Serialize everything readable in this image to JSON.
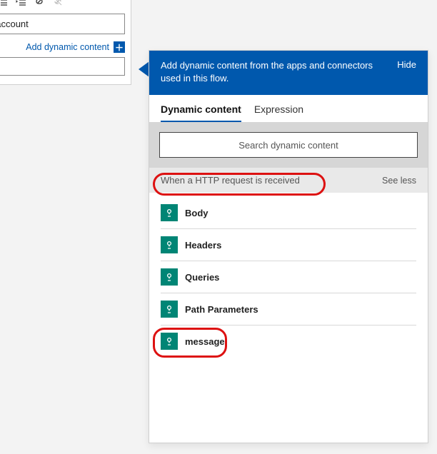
{
  "editor": {
    "text": "me test account",
    "add_dynamic_label": "Add dynamic content",
    "toolbar": {
      "ordered": "ordered-list-icon",
      "unordered": "unordered-list-icon",
      "outdent": "outdent-icon",
      "indent": "indent-icon",
      "link": "link-icon",
      "unlink": "unlink-icon"
    }
  },
  "panel": {
    "header_text": "Add dynamic content from the apps and connectors used in this flow.",
    "hide_label": "Hide",
    "tabs": {
      "dynamic": "Dynamic content",
      "expression": "Expression"
    },
    "search_placeholder": "Search dynamic content",
    "section_title": "When a HTTP request is received",
    "see_less": "See less",
    "items": [
      {
        "label": "Body"
      },
      {
        "label": "Headers"
      },
      {
        "label": "Queries"
      },
      {
        "label": "Path Parameters"
      },
      {
        "label": "message"
      }
    ]
  }
}
